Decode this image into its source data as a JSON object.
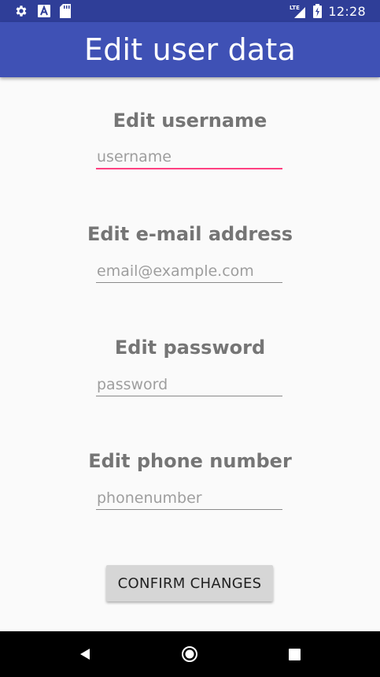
{
  "status_bar": {
    "time": "12:28",
    "network_label": "LTE",
    "icons": [
      "gear-icon",
      "a-icon",
      "sd-card-icon",
      "signal-icon",
      "battery-icon"
    ]
  },
  "app_bar": {
    "title": "Edit user data",
    "color": "#3f51b5"
  },
  "form": {
    "fields": [
      {
        "label": "Edit username",
        "placeholder": "username",
        "value": ""
      },
      {
        "label": "Edit e-mail address",
        "placeholder": "email@example.com",
        "value": ""
      },
      {
        "label": "Edit password",
        "placeholder": "password",
        "value": ""
      },
      {
        "label": "Edit phone number",
        "placeholder": "phonenumber",
        "value": ""
      }
    ],
    "confirm_label": "CONFIRM CHANGES"
  },
  "nav_bar": {
    "icons": [
      "back-icon",
      "home-icon",
      "recents-icon"
    ]
  },
  "colors": {
    "accent": "#ff4081",
    "primary_dark": "#2f3e98",
    "label_gray": "#757575"
  }
}
